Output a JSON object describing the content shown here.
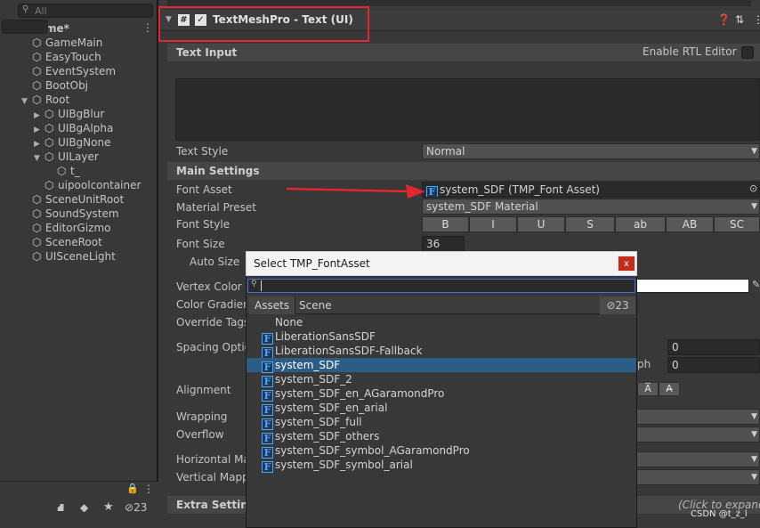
{
  "hierarchy": {
    "search_placeholder": "All",
    "scene_name": "Game*",
    "items": [
      {
        "label": "GameMain",
        "depth": 1,
        "arrow": ""
      },
      {
        "label": "EasyTouch",
        "depth": 1,
        "arrow": ""
      },
      {
        "label": "EventSystem",
        "depth": 1,
        "arrow": ""
      },
      {
        "label": "BootObj",
        "depth": 1,
        "arrow": ""
      },
      {
        "label": "Root",
        "depth": 1,
        "arrow": "▼"
      },
      {
        "label": "UIBgBlur",
        "depth": 2,
        "arrow": "▶"
      },
      {
        "label": "UIBgAlpha",
        "depth": 2,
        "arrow": "▶"
      },
      {
        "label": "UIBgNone",
        "depth": 2,
        "arrow": "▶"
      },
      {
        "label": "UILayer",
        "depth": 2,
        "arrow": "▼"
      },
      {
        "label": "t_",
        "depth": 3,
        "arrow": ""
      },
      {
        "label": "uipoolcontainer",
        "depth": 2,
        "arrow": ""
      },
      {
        "label": "SceneUnitRoot",
        "depth": 1,
        "arrow": ""
      },
      {
        "label": "SoundSystem",
        "depth": 1,
        "arrow": ""
      },
      {
        "label": "EditorGizmo",
        "depth": 1,
        "arrow": ""
      },
      {
        "label": "SceneRoot",
        "depth": 1,
        "arrow": ""
      },
      {
        "label": "UISceneLight",
        "depth": 1,
        "arrow": ""
      }
    ],
    "footer_count": "23"
  },
  "component": {
    "title": "TextMeshPro - Text (UI)",
    "text_input_label": "Text Input",
    "rtl_label": "Enable RTL Editor",
    "text_style_label": "Text Style",
    "text_style_value": "Normal",
    "main_settings_label": "Main Settings",
    "font_asset_label": "Font Asset",
    "font_asset_value": "system_SDF (TMP_Font Asset)",
    "material_preset_label": "Material Preset",
    "material_preset_value": "system_SDF Material",
    "font_style_label": "Font Style",
    "font_style_buttons": [
      "B",
      "I",
      "U",
      "S",
      "ab",
      "AB",
      "SC"
    ],
    "font_size_label": "Font Size",
    "font_size_value": "36",
    "auto_size_label": "Auto Size",
    "vertex_color_label": "Vertex Color",
    "color_gradient_label": "Color Gradien",
    "override_tags_label": "Override Tags",
    "spacing_label": "Spacing Optio",
    "spacing_value_1": "0",
    "spacing_value_2": "0",
    "spacing_clipped_label": "ph",
    "alignment_label": "Alignment",
    "wrapping_label": "Wrapping",
    "overflow_label": "Overflow",
    "horizontal_label": "Horizontal Ma",
    "vertical_label": "Vertical Mapp",
    "extra_settings_label": "Extra Settings",
    "click_to_expand": "(Click to expand)"
  },
  "popup": {
    "title": "Select TMP_FontAsset",
    "close_glyph": "x",
    "tabs": [
      "Assets",
      "Scene"
    ],
    "hidden_count": "23",
    "items": [
      {
        "label": "None",
        "icon": false,
        "selected": false
      },
      {
        "label": "LiberationSansSDF",
        "icon": true,
        "selected": false
      },
      {
        "label": "LiberationSansSDF-Fallback",
        "icon": true,
        "selected": false
      },
      {
        "label": "system_SDF",
        "icon": true,
        "selected": true
      },
      {
        "label": "system_SDF_2",
        "icon": true,
        "selected": false
      },
      {
        "label": "system_SDF_en_AGaramondPro",
        "icon": true,
        "selected": false
      },
      {
        "label": "system_SDF_en_arial",
        "icon": true,
        "selected": false
      },
      {
        "label": "system_SDF_full",
        "icon": true,
        "selected": false
      },
      {
        "label": "system_SDF_others",
        "icon": true,
        "selected": false
      },
      {
        "label": "system_SDF_symbol_AGaramondPro",
        "icon": true,
        "selected": false
      },
      {
        "label": "system_SDF_symbol_arial",
        "icon": true,
        "selected": false
      }
    ]
  },
  "watermark": "CSDN @t_z_l",
  "colors": {
    "annotation_red": "#e0262e",
    "selection_blue": "#2c5d87",
    "font_icon_blue": "#4aa8ff"
  }
}
